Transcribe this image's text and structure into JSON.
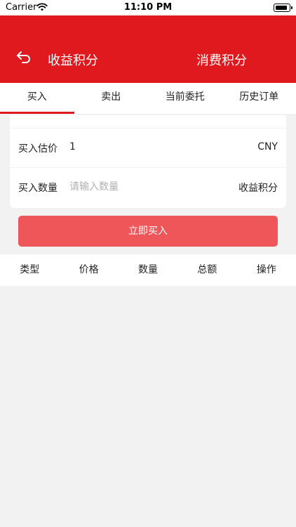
{
  "status_bar": {
    "carrier": "Carrier",
    "time": "11:10 PM"
  },
  "nav": {
    "title_left": "收益积分",
    "title_right": "消费积分",
    "back_icon": "back-arrow-icon",
    "background_color": "#e0191e"
  },
  "tabs": [
    {
      "label": "买入",
      "active": true
    },
    {
      "label": "卖出",
      "active": false
    },
    {
      "label": "当前委托",
      "active": false
    },
    {
      "label": "历史订单",
      "active": false
    }
  ],
  "form": {
    "estimate_label": "买入估价",
    "estimate_value": "1",
    "estimate_unit": "CNY",
    "quantity_label": "买入数量",
    "quantity_placeholder": "请输入数量",
    "quantity_value": "",
    "quantity_unit": "收益积分"
  },
  "buy_button": {
    "label": "立即买入",
    "color": "#ef5659"
  },
  "table": {
    "columns": [
      "类型",
      "价格",
      "数量",
      "总额",
      "操作"
    ]
  }
}
